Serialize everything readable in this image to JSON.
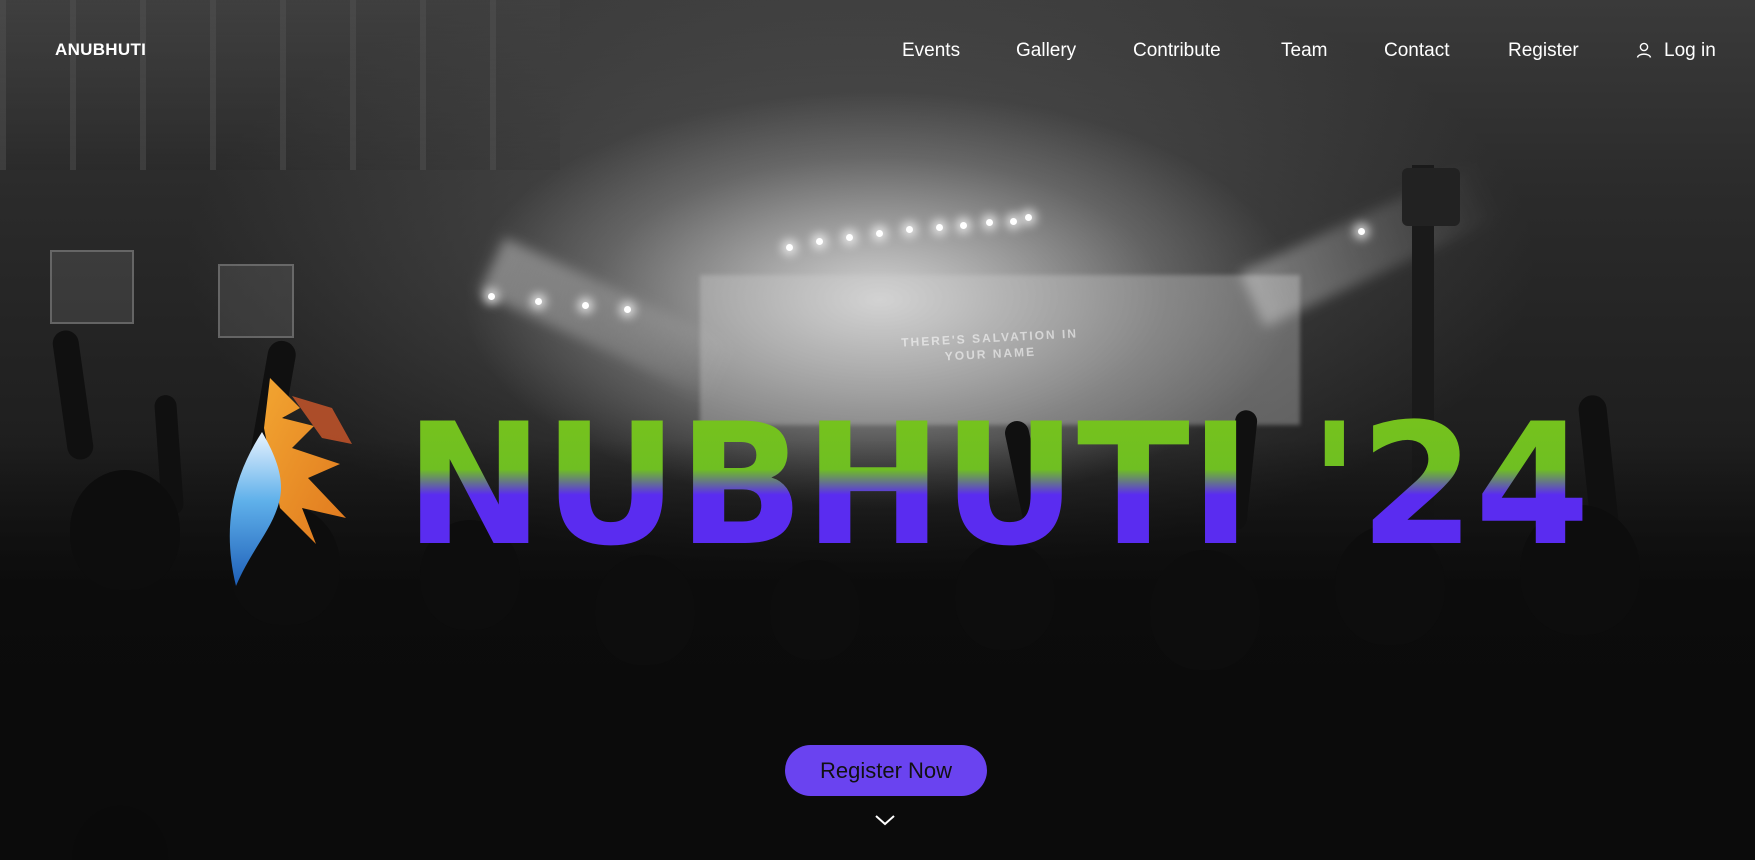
{
  "brand": {
    "name": "ANUBHUTI"
  },
  "nav": {
    "items": [
      {
        "label": "Events"
      },
      {
        "label": "Gallery"
      },
      {
        "label": "Contribute"
      },
      {
        "label": "Team"
      },
      {
        "label": "Contact"
      },
      {
        "label": "Register"
      }
    ],
    "login_label": "Log in",
    "login_icon": "user-icon"
  },
  "hero": {
    "title": "NUBHUTI '24",
    "background_screen_text": "THERE'S SALVATION IN YOUR NAME",
    "cta_label": "Register Now",
    "scroll_icon": "chevron-down-icon"
  },
  "colors": {
    "accent": "#6a43f0",
    "title_violet": "#5a2cf0",
    "title_green": "#7ac41a",
    "text": "#ffffff"
  }
}
